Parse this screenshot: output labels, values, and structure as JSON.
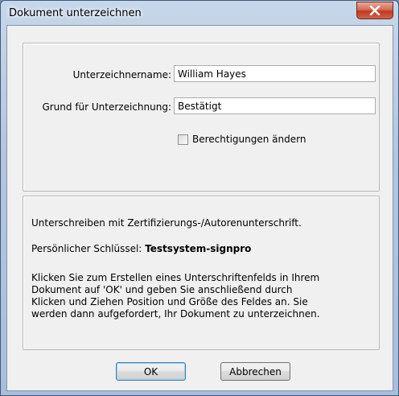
{
  "window": {
    "title": "Dokument unterzeichnen"
  },
  "form": {
    "signer_name_label": "Unterzeichnername:",
    "signer_name_value": "William Hayes",
    "reason_label": "Grund für Unterzeichnung:",
    "reason_value": "Bestätigt",
    "permissions_checkbox_label": "Berechtigungen ändern",
    "permissions_checked": false
  },
  "info": {
    "sign_type_text": "Unterschreiben mit Zertifizierungs-/Autorenunterschrift.",
    "key_label": "Persönlicher Schlüssel:",
    "key_value": "Testsystem-signpro",
    "instructions_lines": [
      "Klicken Sie zum Erstellen eines Unterschriftenfelds in Ihrem",
      "Dokument auf 'OK' und geben Sie anschließend durch",
      "Klicken und Ziehen Position und Größe des Feldes an. Sie",
      "werden dann aufgefordert, Ihr Dokument zu unterzeichnen."
    ]
  },
  "buttons": {
    "ok_label": "OK",
    "cancel_label": "Abbrechen"
  },
  "icons": {
    "close": "close-icon"
  }
}
